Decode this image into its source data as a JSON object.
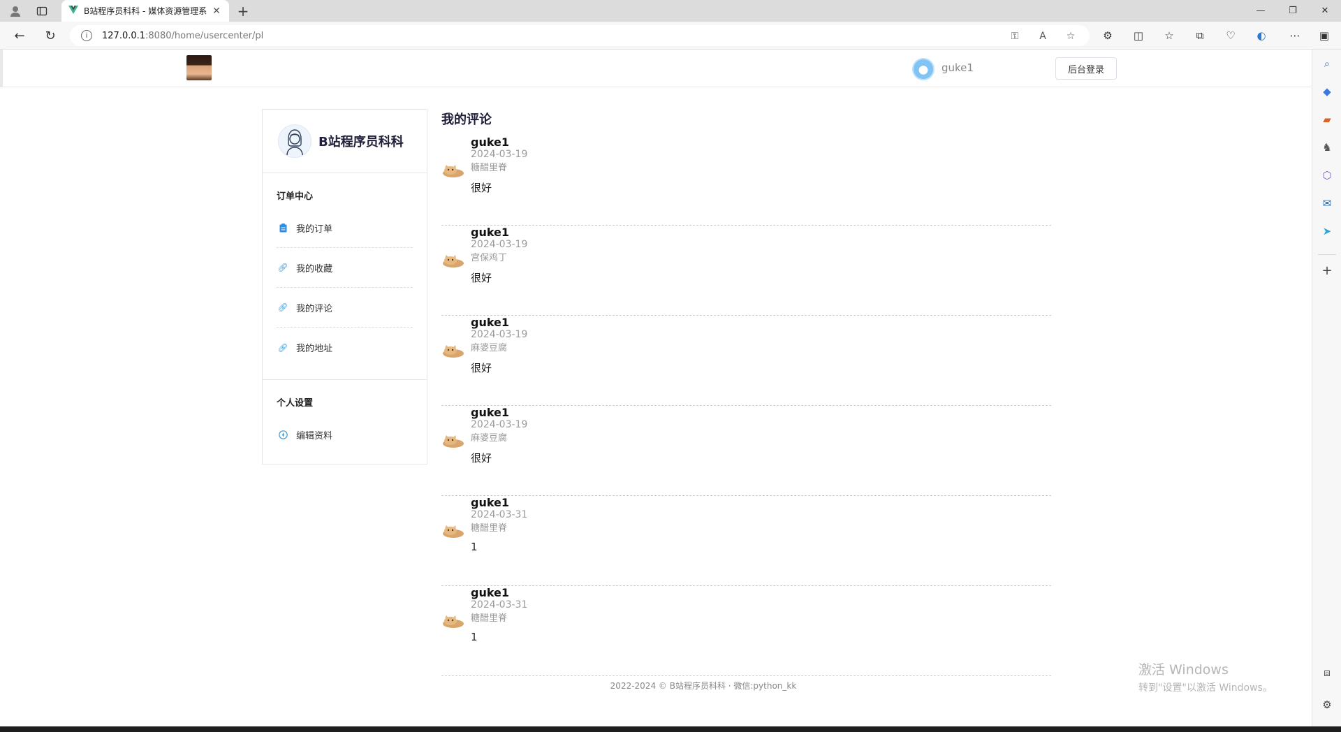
{
  "browser": {
    "tab_title": "B站程序员科科 - 媒体资源管理系",
    "url_host": "127.0.0.1",
    "url_path": ":8080/home/usercenter/pl"
  },
  "header": {
    "username": "guke1",
    "admin_login_label": "后台登录"
  },
  "sidebar": {
    "brand_name": "B站程序员科科",
    "order_center_title": "订单中心",
    "order_items": [
      {
        "label": "我的订单",
        "icon": "clipboard-icon"
      },
      {
        "label": "我的收藏",
        "icon": "link-icon"
      },
      {
        "label": "我的评论",
        "icon": "link-icon"
      },
      {
        "label": "我的地址",
        "icon": "link-icon"
      }
    ],
    "settings_title": "个人设置",
    "settings_items": [
      {
        "label": "编辑资料",
        "icon": "compass-icon"
      }
    ]
  },
  "main": {
    "title": "我的评论",
    "comments": [
      {
        "user": "guke1",
        "date": "2024-03-19",
        "dish": "糖醋里脊",
        "text": "很好"
      },
      {
        "user": "guke1",
        "date": "2024-03-19",
        "dish": "宫保鸡丁",
        "text": "很好"
      },
      {
        "user": "guke1",
        "date": "2024-03-19",
        "dish": "麻婆豆腐",
        "text": "很好"
      },
      {
        "user": "guke1",
        "date": "2024-03-19",
        "dish": "麻婆豆腐",
        "text": "很好"
      },
      {
        "user": "guke1",
        "date": "2024-03-31",
        "dish": "糖醋里脊",
        "text": "1"
      },
      {
        "user": "guke1",
        "date": "2024-03-31",
        "dish": "糖醋里脊",
        "text": "1"
      }
    ]
  },
  "footer": {
    "text": "2022-2024 © B站程序员科科 · 微信:python_kk"
  },
  "watermark": {
    "line1": "激活 Windows",
    "line2": "转到\"设置\"以激活 Windows。"
  },
  "colors": {
    "accent": "#3a9ad9",
    "title": "#1f1f3a",
    "muted": "#9a9a9a"
  }
}
